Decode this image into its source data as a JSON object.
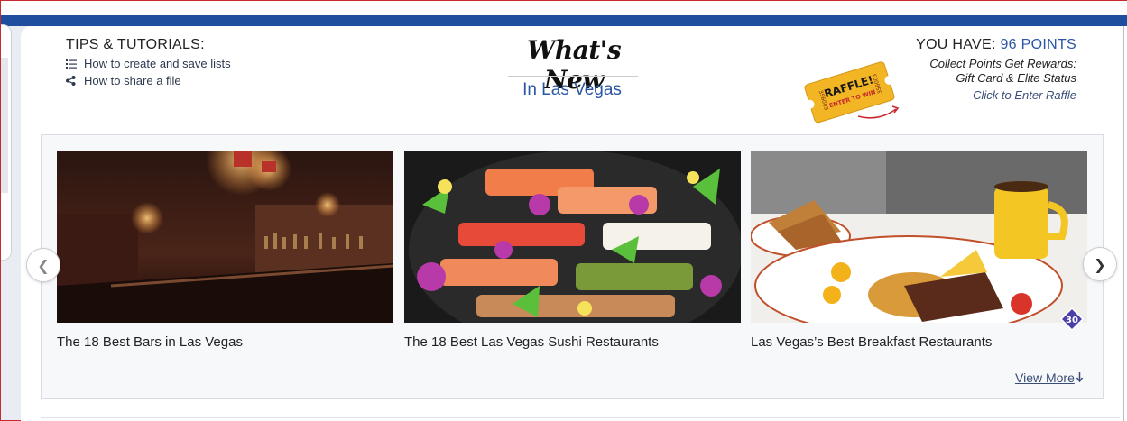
{
  "tips": {
    "title": "TIPS & TUTORIALS:",
    "links": [
      {
        "label": "How to create and save lists",
        "icon": "list-icon"
      },
      {
        "label": "How to share a file",
        "icon": "share-icon"
      }
    ]
  },
  "header": {
    "title": "What's New",
    "subtitle": "In Las Vegas"
  },
  "raffle": {
    "ticket_top": "RAFFLE!",
    "ticket_bottom": "ENTER TO WIN",
    "ticket_number": "356003"
  },
  "points": {
    "label": "YOU HAVE: ",
    "value": "96 POINTS",
    "line1": "Collect Points Get Rewards:",
    "line2": "Gift Card & Elite Status",
    "enter_link": "Click to Enter Raffle"
  },
  "carousel": {
    "cards": [
      {
        "title": "The 18 Best Bars in Las Vegas"
      },
      {
        "title": "The 18 Best Las Vegas Sushi Restaurants"
      },
      {
        "title": "Las Vegas’s Best Breakfast Restaurants",
        "badge": "30"
      }
    ],
    "prev": "❮",
    "next": "❯",
    "view_more": "View More"
  },
  "colors": {
    "accent_blue": "#2a56a4",
    "band_blue": "#1f4e9f",
    "ticket_yellow": "#f2b523",
    "ticket_red": "#c8292e"
  }
}
